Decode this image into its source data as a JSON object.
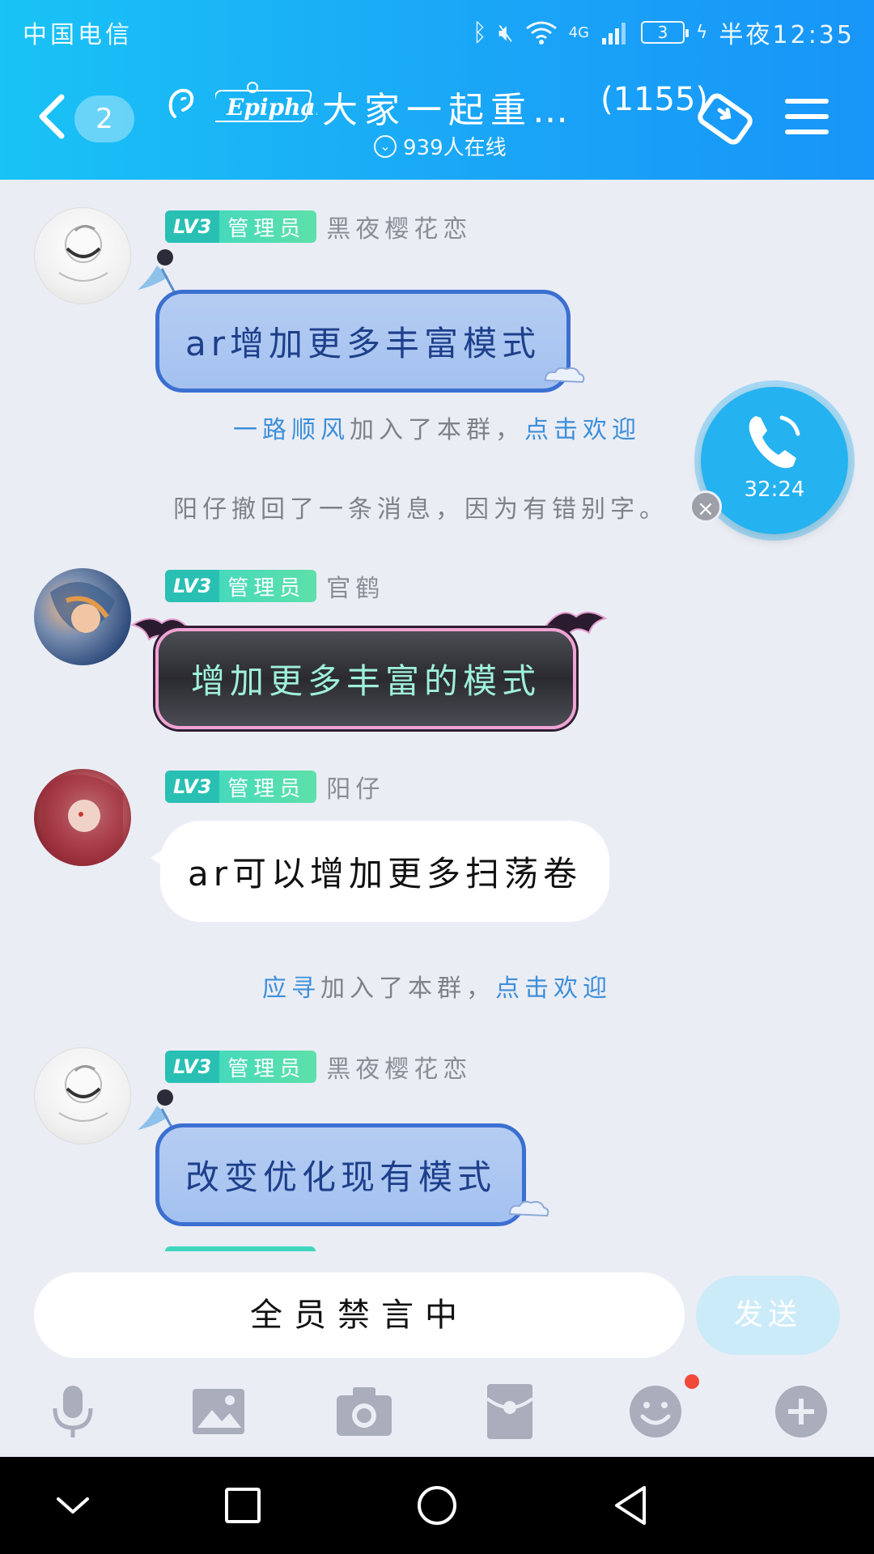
{
  "status_bar": {
    "carrier": "中国电信",
    "network": "4G",
    "battery": "3",
    "time": "半夜12:35"
  },
  "header": {
    "unread_badge": "2",
    "logo_text": "Epiphany",
    "group_name": "大家一起重…",
    "member_count": "(1155)",
    "online_text": "939人在线"
  },
  "messages": [
    {
      "type": "chat",
      "level": "LV3",
      "role": "管理员",
      "sender": "黑夜樱花恋",
      "text": "ar增加更多丰富模式",
      "bubble_style": "blue"
    },
    {
      "type": "join",
      "name": "一路顺风",
      "suffix": "加入了本群，",
      "action": "点击欢迎"
    },
    {
      "type": "system",
      "text": "阳仔撤回了一条消息，因为有错别字。"
    },
    {
      "type": "chat",
      "level": "LV3",
      "role": "管理员",
      "sender": "官鹤",
      "text": "增加更多丰富的模式",
      "bubble_style": "dark"
    },
    {
      "type": "chat",
      "level": "LV3",
      "role": "管理员",
      "sender": "阳仔",
      "text": "ar可以增加更多扫荡卷",
      "bubble_style": "white"
    },
    {
      "type": "join",
      "name": "应寻",
      "suffix": "加入了本群，",
      "action": "点击欢迎"
    },
    {
      "type": "chat",
      "level": "LV3",
      "role": "管理员",
      "sender": "黑夜樱花恋",
      "text": "改变优化现有模式",
      "bubble_style": "blue"
    }
  ],
  "call": {
    "duration": "32:24"
  },
  "input": {
    "muted_text": "全员禁言中",
    "send_label": "发送"
  },
  "toolbar_icons": [
    "microphone-icon",
    "image-icon",
    "camera-icon",
    "red-packet-icon",
    "emoji-icon",
    "plus-icon"
  ],
  "colors": {
    "header_start": "#19c3f5",
    "header_end": "#1795f8",
    "link_blue": "#3d8fd9",
    "admin_tag": "#39d6c6"
  }
}
